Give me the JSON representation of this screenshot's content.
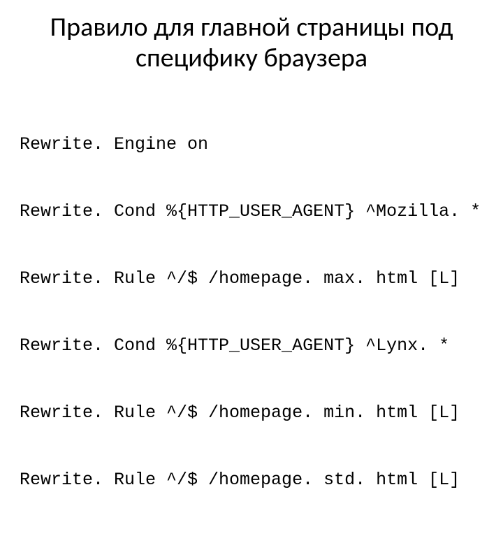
{
  "title_line1": "Правило для главной страницы под",
  "title_line2": "специфику браузера",
  "code": {
    "l1": "Rewrite. Engine on",
    "l2": "Rewrite. Cond %{HTTP_USER_AGENT} ^Mozilla. *",
    "l3": "Rewrite. Rule ^/$ /homepage. max. html [L]",
    "l4": "Rewrite. Cond %{HTTP_USER_AGENT} ^Lynx. *",
    "l5": "Rewrite. Rule ^/$ /homepage. min. html [L]",
    "l6": "Rewrite. Rule ^/$ /homepage. std. html [L]"
  }
}
